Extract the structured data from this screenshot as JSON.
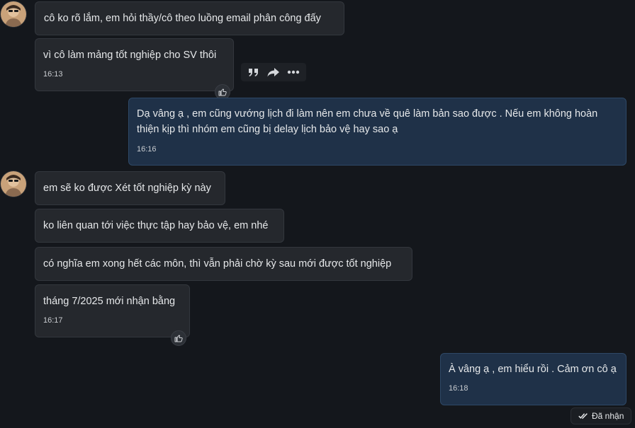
{
  "messages": [
    {
      "text": "cô ko rõ lắm, em hỏi thầy/cô theo luồng email phân công đấy"
    },
    {
      "text": "vì cô làm mảng tốt nghiệp cho SV thôi",
      "time": "16:13"
    },
    {
      "text": "Dạ vâng ạ , em cũng vướng lịch đi làm nên em chưa về quê làm bản sao được . Nếu em không hoàn thiện kịp thì nhóm em cũng bị delay lịch bảo vệ hay sao ạ",
      "time": "16:16"
    },
    {
      "text": "em sẽ ko được Xét tốt nghiệp kỳ này"
    },
    {
      "text": "ko liên quan tới việc thực tập hay bảo vệ, em nhé"
    },
    {
      "text": "có nghĩa em xong hết các môn, thì vẫn phải chờ kỳ sau mới được tốt nghiệp"
    },
    {
      "text": "tháng 7/2025 mới nhận bằng",
      "time": "16:17"
    },
    {
      "text": "À vâng ạ , em hiểu rồi . Cảm ơn cô ạ",
      "time": "16:18"
    }
  ],
  "status": {
    "seen_label": "Đã nhận"
  },
  "icons": {
    "quote": "quote-icon",
    "forward": "forward-icon",
    "more": "more-icon",
    "like": "thumbs-up-icon",
    "seen": "double-check-icon"
  },
  "colors": {
    "background": "#14171c",
    "incoming_bubble": "#25282d",
    "outgoing_bubble": "#1f3148"
  }
}
